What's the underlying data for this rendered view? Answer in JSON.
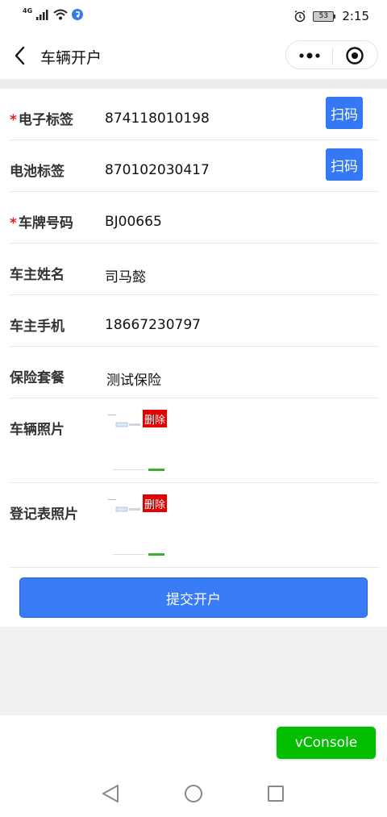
{
  "status_bar": {
    "network": "4G",
    "battery": "53",
    "time": "2:15"
  },
  "nav": {
    "title": "车辆开户"
  },
  "form": {
    "required_mark": "*",
    "rows": [
      {
        "label": "电子标签",
        "value": "874118010198",
        "required": true,
        "button": "扫码"
      },
      {
        "label": "电池标签",
        "value": "870102030417",
        "required": false,
        "button": "扫码"
      },
      {
        "label": "车牌号码",
        "value": "BJ00665",
        "required": true
      },
      {
        "label": "车主姓名",
        "value": "司马懿",
        "required": false
      },
      {
        "label": "车主手机",
        "value": "18667230797",
        "required": false
      },
      {
        "label": "保险套餐",
        "value": "测试保险",
        "required": false
      }
    ],
    "photos": [
      {
        "label": "车辆照片",
        "delete_label": "删除"
      },
      {
        "label": "登记表照片",
        "delete_label": "删除"
      }
    ],
    "submit_label": "提交开户"
  },
  "debug": {
    "vconsole_label": "vConsole"
  },
  "colors": {
    "primary": "#3478f6",
    "danger": "#e00000",
    "vconsole": "#04be02",
    "required": "#e02020"
  }
}
